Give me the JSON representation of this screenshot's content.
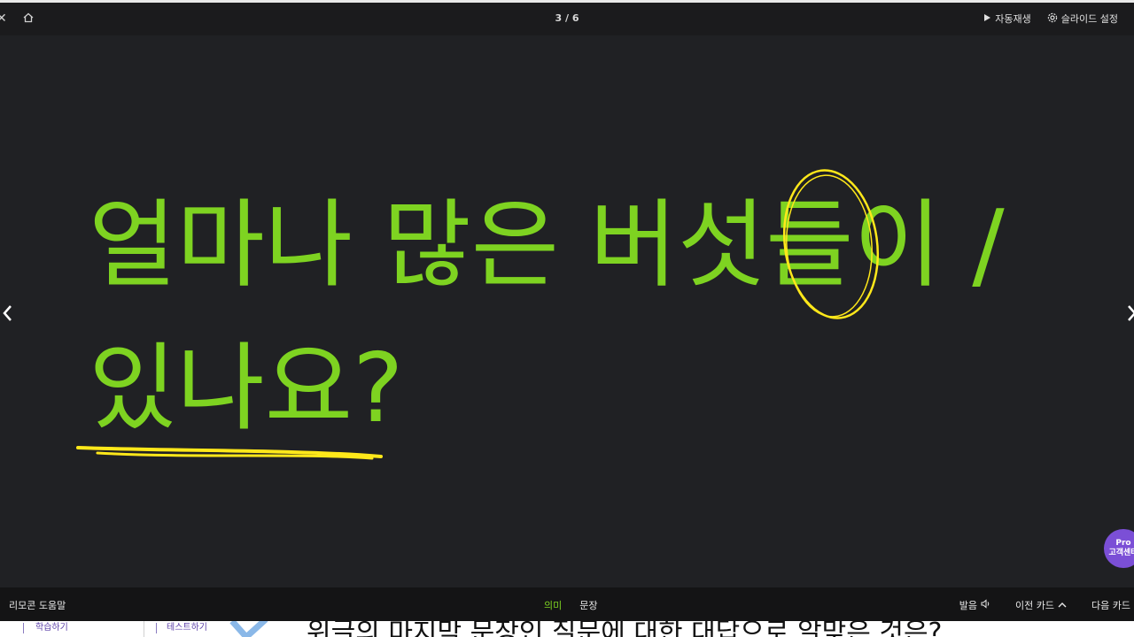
{
  "topbar": {
    "close_icon": "close-icon",
    "home_icon": "home-icon",
    "counter": "3 / 6",
    "autoplay_label": "자동재생",
    "settings_label": "슬라이드 설정"
  },
  "slide": {
    "line1": "얼마나 많은 버섯들이 /",
    "line2": "있나요?",
    "text_color": "#7ed321",
    "annotation_color": "#ffe81a"
  },
  "pro_badge": {
    "line1": "Pro",
    "line2": "고객센터"
  },
  "bottombar": {
    "help_label": "리모콘 도움말",
    "tab_meaning": "의미",
    "tab_sentence": "문장",
    "pronounce_label": "발음",
    "prev_label": "이전 카드",
    "next_label": "다음 카드"
  },
  "background": {
    "text1": "학습하기",
    "text2": "테스트하기",
    "question": "위글의 마지막 문장인 질문에 대한 대답으로 알맞은 것은?"
  }
}
